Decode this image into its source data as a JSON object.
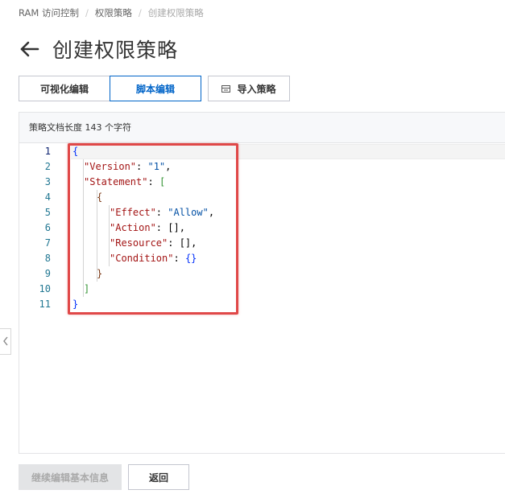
{
  "breadcrumb": {
    "items": [
      "RAM 访问控制",
      "权限策略",
      "创建权限策略"
    ],
    "separator": "/"
  },
  "header": {
    "title": "创建权限策略",
    "back_icon": "arrow-left-icon"
  },
  "tabs": {
    "visual_label": "可视化编辑",
    "script_label": "脚本编辑",
    "active": "script",
    "accent_color": "#0064c8"
  },
  "toolbar": {
    "import_label": "导入策略",
    "import_icon": "import-icon"
  },
  "editor": {
    "doc_length_text": "策略文档长度 143 个字符",
    "line_numbers": [
      "1",
      "2",
      "3",
      "4",
      "5",
      "6",
      "7",
      "8",
      "9",
      "10",
      "11"
    ],
    "active_line": "1",
    "code": {
      "open_root": "{",
      "version_key": "\"Version\"",
      "version_colon": ": ",
      "version_value": "\"1\"",
      "version_comma": ",",
      "statement_key": "\"Statement\"",
      "statement_colon": ": ",
      "statement_open": "[",
      "stmt_open": "{",
      "effect_key": "\"Effect\"",
      "effect_colon": ": ",
      "effect_value": "\"Allow\"",
      "effect_comma": ",",
      "action_key": "\"Action\"",
      "action_rest": ": [],",
      "resource_key": "\"Resource\"",
      "resource_rest": ": [],",
      "condition_key": "\"Condition\"",
      "condition_colon": ": ",
      "condition_value": "{}",
      "stmt_close": "}",
      "statement_close": "]",
      "close_root": "}"
    },
    "highlight_color": "#e04848"
  },
  "footer": {
    "continue_label": "继续编辑基本信息",
    "back_label": "返回"
  }
}
